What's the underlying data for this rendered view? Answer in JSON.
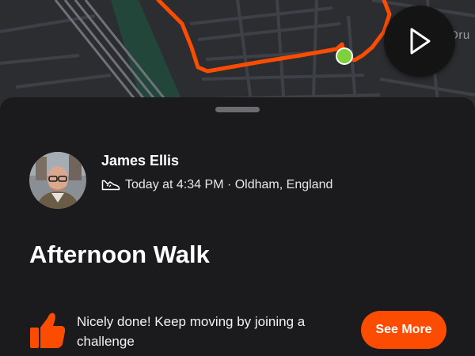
{
  "map": {
    "partial_label": "Dru",
    "route_color": "#fc4c02",
    "start_marker_color": "#7dd13b"
  },
  "play_button": {
    "icon": "play-icon"
  },
  "athlete": {
    "name": "James Ellis",
    "activity_icon": "shoe-icon",
    "meta": "Today at 4:34 PM · Oldham, England"
  },
  "activity": {
    "title": "Afternoon Walk"
  },
  "kudos": {
    "icon": "thumbs-up-icon",
    "message": "Nicely done! Keep moving by joining a challenge",
    "button_label": "See More"
  },
  "colors": {
    "accent": "#fc4c02",
    "sheet_background": "#1b1b1d",
    "map_background": "#2b2d31"
  }
}
